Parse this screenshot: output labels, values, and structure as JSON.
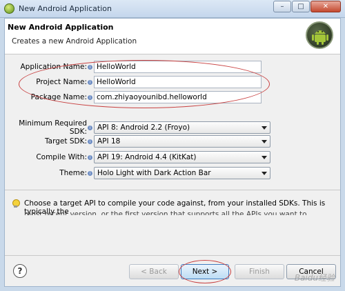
{
  "window": {
    "title": "New Android Application",
    "controls": {
      "minimize": "–",
      "maximize": "□",
      "close": "✕"
    }
  },
  "header": {
    "title": "New Android Application",
    "subtitle": "Creates a new Android Application",
    "logo_icon": "android-logo-icon"
  },
  "form": {
    "application_name": {
      "label": "Application Name:",
      "value": "HelloWorld"
    },
    "project_name": {
      "label": "Project Name:",
      "value": "HelloWorld"
    },
    "package_name": {
      "label": "Package Name:",
      "value": "com.zhiyaoyounibd.helloworld"
    },
    "min_sdk": {
      "label": "Minimum Required SDK:",
      "value": "API 8: Android 2.2 (Froyo)"
    },
    "target_sdk": {
      "label": "Target SDK:",
      "value": "API 18"
    },
    "compile_with": {
      "label": "Compile With:",
      "value": "API 19: Android 4.4 (KitKat)"
    },
    "theme": {
      "label": "Theme:",
      "value": "Holo Light with Dark Action Bar"
    }
  },
  "hint": {
    "text": "Choose a target API to compile your code against, from your installed SDKs. This is typically the",
    "cut_text": "most recent version, or the first version that supports all the APIs you want to directly access without"
  },
  "footer": {
    "help": "?",
    "back": "< Back",
    "next": "Next >",
    "finish": "Finish",
    "cancel": "Cancel"
  },
  "watermark": "Baidu经验",
  "colors": {
    "annotation": "#c84040",
    "accent": "#3d7bbf"
  }
}
